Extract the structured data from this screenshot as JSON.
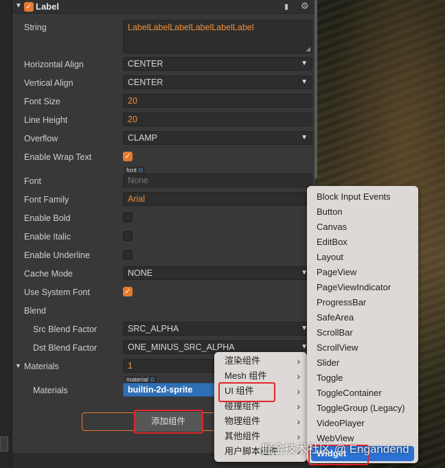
{
  "component": {
    "title": "Label",
    "enabled": true,
    "icons": [
      "book-icon",
      "gear-icon"
    ]
  },
  "properties": {
    "string": {
      "label": "String",
      "value": "LabelLabelLabelLabelLabelLabel"
    },
    "horizontal_align": {
      "label": "Horizontal Align",
      "value": "CENTER"
    },
    "vertical_align": {
      "label": "Vertical Align",
      "value": "CENTER"
    },
    "font_size": {
      "label": "Font Size",
      "value": "20"
    },
    "line_height": {
      "label": "Line Height",
      "value": "20"
    },
    "overflow": {
      "label": "Overflow",
      "value": "CLAMP"
    },
    "enable_wrap_text": {
      "label": "Enable Wrap Text",
      "checked": true
    },
    "font": {
      "label": "Font",
      "tag": "font",
      "value": "None"
    },
    "font_family": {
      "label": "Font Family",
      "value": "Arial"
    },
    "enable_bold": {
      "label": "Enable Bold",
      "checked": false
    },
    "enable_italic": {
      "label": "Enable Italic",
      "checked": false
    },
    "enable_underline": {
      "label": "Enable Underline",
      "checked": false
    },
    "cache_mode": {
      "label": "Cache Mode",
      "value": "NONE"
    },
    "use_system_font": {
      "label": "Use System Font",
      "checked": true
    },
    "blend": {
      "label": "Blend"
    },
    "src_blend_factor": {
      "label": "Src Blend Factor",
      "value": "SRC_ALPHA"
    },
    "dst_blend_factor": {
      "label": "Dst Blend Factor",
      "value": "ONE_MINUS_SRC_ALPHA"
    },
    "materials_group": {
      "label": "Materials",
      "value": "1"
    },
    "materials": {
      "label": "Materials",
      "tag": "material",
      "value": "builtin-2d-sprite"
    }
  },
  "add_component_button": {
    "label": "添加组件"
  },
  "category_menu": [
    {
      "label": "渲染组件",
      "has_submenu": true
    },
    {
      "label": "Mesh 组件",
      "has_submenu": true
    },
    {
      "label": "UI 组件",
      "has_submenu": true
    },
    {
      "label": "碰撞组件",
      "has_submenu": true
    },
    {
      "label": "物理组件",
      "has_submenu": true
    },
    {
      "label": "其他组件",
      "has_submenu": true
    },
    {
      "label": "用户脚本组件",
      "has_submenu": true
    }
  ],
  "ui_component_menu": [
    "Block Input Events",
    "Button",
    "Canvas",
    "EditBox",
    "Layout",
    "PageView",
    "PageViewIndicator",
    "ProgressBar",
    "SafeArea",
    "ScrollBar",
    "ScrollView",
    "Slider",
    "Toggle",
    "ToggleContainer",
    "ToggleGroup (Legacy)",
    "VideoPlayer",
    "WebView",
    "Widget"
  ],
  "highlighted_item": "Widget",
  "watermark": "掘金技术社区 @ Engandend",
  "colors": {
    "accent": "#e8792b",
    "highlight": "#2d72d2",
    "annotation": "#e0262b"
  }
}
